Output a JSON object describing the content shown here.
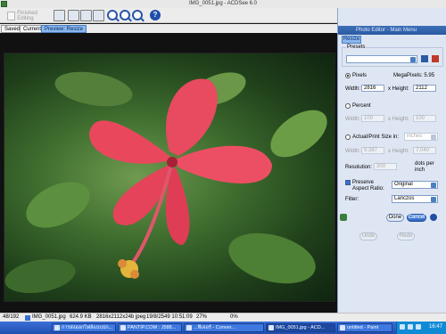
{
  "window": {
    "title": "IMG_0051.jpg - ACDSee 6.0"
  },
  "toolbar": {
    "finished_editing": "Finished Editing"
  },
  "tabs": [
    {
      "label": "Saved"
    },
    {
      "label": "Current"
    },
    {
      "label": "Preview: Resize"
    }
  ],
  "panel": {
    "title": "Photo Editor - Main Menu",
    "tab": "Resize",
    "presets_label": "Presets",
    "pixels_label": "Pixels",
    "megapixels_label": "MegaPixels: 5.95",
    "width_label": "Width:",
    "width_value": "2816",
    "height_label": "x Height:",
    "height_value": "2112",
    "percent_label": "Percent",
    "percent_width_label": "Width:",
    "percent_width_value": "100",
    "percent_height_label": "x Height:",
    "percent_height_value": "100",
    "actual_label": "Actual/Print Size in:",
    "actual_unit": "inches",
    "actual_width_label": "Width:",
    "actual_width_value": "9.387",
    "actual_height_label": "x Height:",
    "actual_height_value": "7.040",
    "resolution_label": "Resolution:",
    "resolution_value": "300",
    "resolution_unit": "dots per inch",
    "preserve_label": "Preserve Aspect Ratio:",
    "preserve_value": "Original",
    "filter_label": "Filter:",
    "filter_value": "Lanczos",
    "done": "Done",
    "cancel": "Cancel",
    "undo": "Undo",
    "redo": "Redo"
  },
  "status": {
    "index": "48/192",
    "filename": "IMG_0051.jpg",
    "size": "624.9 KB",
    "dims": "2816x2112x24b jpeg",
    "date": "19/8/2549 10:51:09",
    "zoom": "27%",
    "progress": "0%"
  },
  "taskbar": {
    "items": [
      {
        "label": "การส่งออกไฟล์แบบปก..."
      },
      {
        "label": "PANTIP.COM : J588..."
      },
      {
        "label": "...ฟีเจอร์ - Conver..."
      },
      {
        "label": "IMG_0051.jpg - ACD..."
      },
      {
        "label": "untitled - Paint"
      }
    ],
    "clock": "16:47"
  }
}
